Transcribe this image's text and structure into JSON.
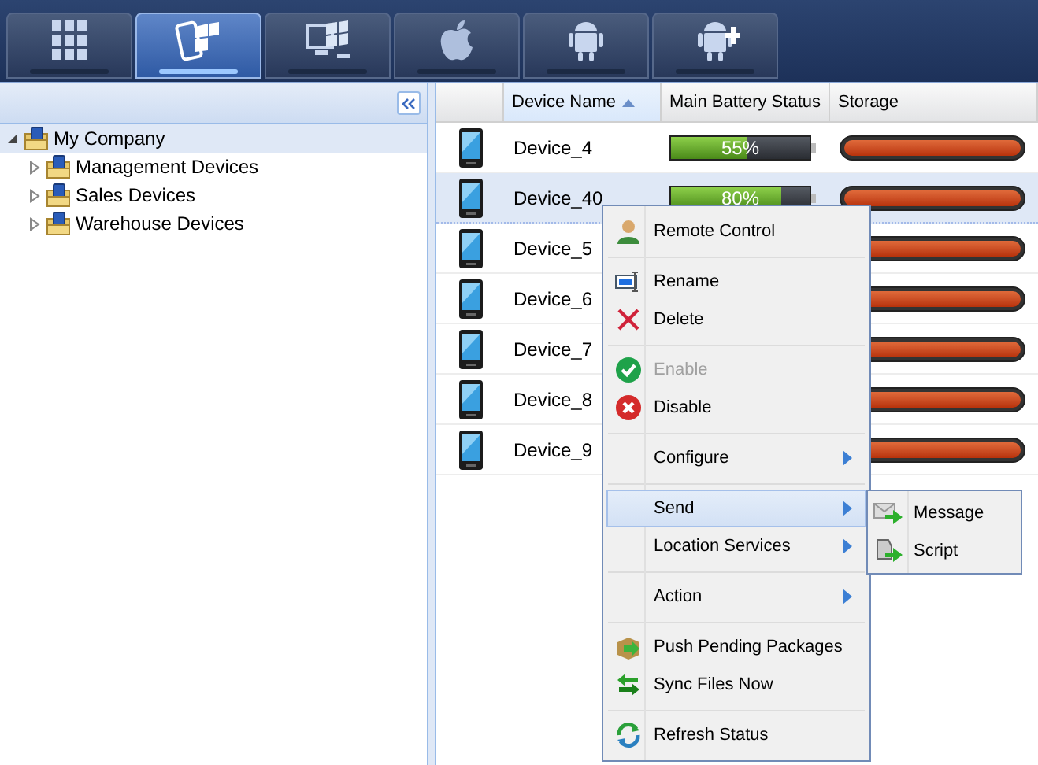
{
  "tabs": [
    {
      "selected": false
    },
    {
      "selected": true
    },
    {
      "selected": false
    },
    {
      "selected": false
    },
    {
      "selected": false
    },
    {
      "selected": false
    }
  ],
  "tree": {
    "label": "My Company",
    "expanded": true,
    "selected": true,
    "children": [
      {
        "label": "Management Devices",
        "expanded": false,
        "selected": false
      },
      {
        "label": "Sales Devices",
        "expanded": false,
        "selected": false
      },
      {
        "label": "Warehouse Devices",
        "expanded": false,
        "selected": false
      }
    ]
  },
  "table": {
    "columns": [
      {
        "label": "Device Name",
        "sorted": true
      },
      {
        "label": "Main Battery Status",
        "sorted": false
      },
      {
        "label": "Storage",
        "sorted": false
      }
    ],
    "rows": [
      {
        "name": "Device_4",
        "selected": false,
        "battery": {
          "level": 0.55,
          "reading": "55%"
        },
        "storage": {
          "level": 1
        }
      },
      {
        "name": "Device_40",
        "selected": true,
        "battery": {
          "level": 0.8,
          "reading": "80%"
        },
        "storage": {
          "level": 1
        }
      },
      {
        "name": "Device_5",
        "selected": false,
        "storage": {
          "level": 1
        }
      },
      {
        "name": "Device_6",
        "selected": false,
        "storage": {
          "level": 1
        }
      },
      {
        "name": "Device_7",
        "selected": false,
        "storage": {
          "level": 1
        }
      },
      {
        "name": "Device_8",
        "selected": false,
        "storage": {
          "level": 1
        }
      },
      {
        "name": "Device_9",
        "selected": false,
        "storage": {
          "level": 1
        }
      }
    ]
  },
  "context_menu": {
    "groups": [
      [
        {
          "label": "Remote Control",
          "disabled": false,
          "selected": false,
          "submenu": false
        }
      ],
      [
        {
          "label": "Rename",
          "disabled": false,
          "selected": false,
          "submenu": false
        },
        {
          "label": "Delete",
          "disabled": false,
          "selected": false,
          "submenu": false
        }
      ],
      [
        {
          "label": "Enable",
          "disabled": true,
          "selected": false,
          "submenu": false
        },
        {
          "label": "Disable",
          "disabled": false,
          "selected": false,
          "submenu": false
        }
      ],
      [
        {
          "label": "Configure",
          "disabled": false,
          "selected": false,
          "submenu": true
        }
      ],
      [
        {
          "label": "Send",
          "disabled": false,
          "selected": true,
          "submenu": true
        },
        {
          "label": "Location Services",
          "disabled": false,
          "selected": false,
          "submenu": true
        }
      ],
      [
        {
          "label": "Action",
          "disabled": false,
          "selected": false,
          "submenu": true
        }
      ],
      [
        {
          "label": "Push Pending Packages",
          "disabled": false,
          "selected": false,
          "submenu": false
        },
        {
          "label": "Sync Files Now",
          "disabled": false,
          "selected": false,
          "submenu": false
        }
      ],
      [
        {
          "label": "Refresh Status",
          "disabled": false,
          "selected": false,
          "submenu": false
        }
      ]
    ],
    "submenu": {
      "items": [
        {
          "label": "Message"
        },
        {
          "label": "Script"
        }
      ]
    }
  }
}
